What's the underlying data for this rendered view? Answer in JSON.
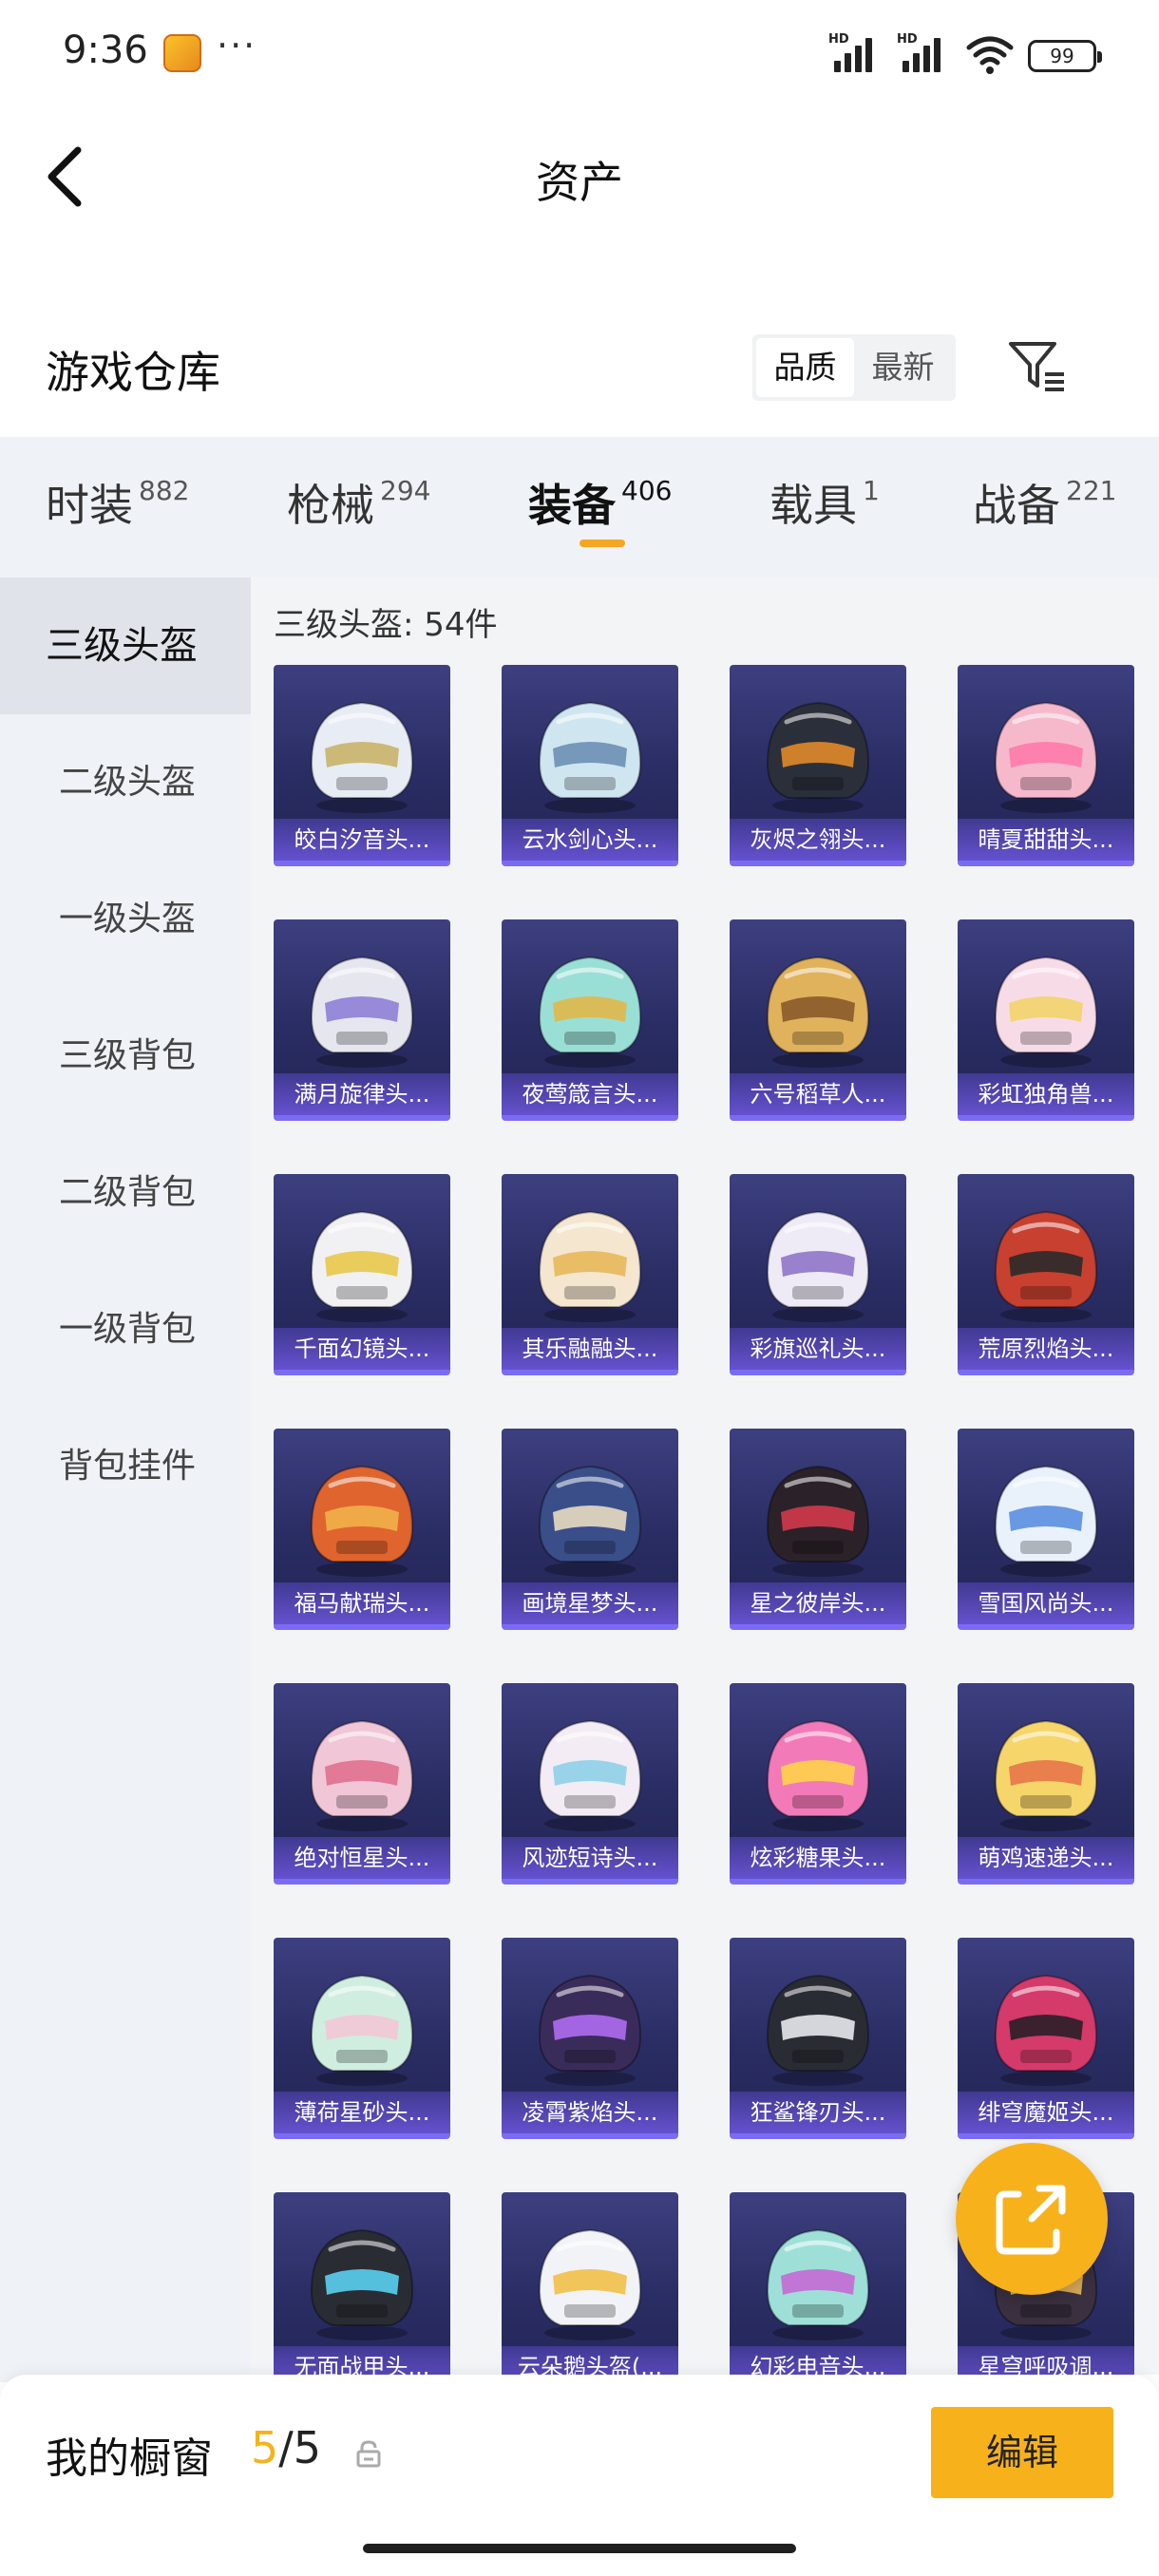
{
  "status_bar": {
    "time": "9:36",
    "more": "···",
    "network1": "HD",
    "network2": "HD",
    "battery": "99"
  },
  "header": {
    "title": "资产"
  },
  "section": {
    "title": "游戏仓库"
  },
  "sort": {
    "options": [
      "品质",
      "最新"
    ],
    "active": "品质"
  },
  "tabs": [
    {
      "label": "时装",
      "count": "882"
    },
    {
      "label": "枪械",
      "count": "294"
    },
    {
      "label": "装备",
      "count": "406",
      "active": true
    },
    {
      "label": "载具",
      "count": "1"
    },
    {
      "label": "战备",
      "count": "221"
    }
  ],
  "sidebar": {
    "items": [
      "三级头盔",
      "二级头盔",
      "一级头盔",
      "三级背包",
      "二级背包",
      "一级背包",
      "背包挂件"
    ],
    "active": "三级头盔"
  },
  "grid": {
    "label": "三级头盔: 54件",
    "items": [
      {
        "name": "皎白汐音头...",
        "color": "#e8ecf4",
        "accent": "#c9b46a"
      },
      {
        "name": "云水剑心头...",
        "color": "#cfe6f0",
        "accent": "#6a8fb5"
      },
      {
        "name": "灰烬之翎头...",
        "color": "#2b2f3a",
        "accent": "#e08a2a"
      },
      {
        "name": "晴夏甜甜头...",
        "color": "#f6b9cc",
        "accent": "#ff7aa8"
      },
      {
        "name": "满月旋律头...",
        "color": "#e6e6ef",
        "accent": "#8e7fd6"
      },
      {
        "name": "夜莺箴言头...",
        "color": "#9adfd6",
        "accent": "#e0b84a"
      },
      {
        "name": "六号稻草人...",
        "color": "#e0b25b",
        "accent": "#8a5a2a"
      },
      {
        "name": "彩虹独角兽...",
        "color": "#f7dce8",
        "accent": "#f2d36a"
      },
      {
        "name": "千面幻镜头...",
        "color": "#f1f1f4",
        "accent": "#e8c84a"
      },
      {
        "name": "其乐融融头...",
        "color": "#f4e6cf",
        "accent": "#e8b85a"
      },
      {
        "name": "彩旗巡礼头...",
        "color": "#eeeaf6",
        "accent": "#8f76c9"
      },
      {
        "name": "荒原烈焰头...",
        "color": "#c8402f",
        "accent": "#2a2a2a"
      },
      {
        "name": "福马献瑞头...",
        "color": "#e0642e",
        "accent": "#f2b04a"
      },
      {
        "name": "画境星梦头...",
        "color": "#3a4e8a",
        "accent": "#e9dcc0"
      },
      {
        "name": "星之彼岸头...",
        "color": "#2a2228",
        "accent": "#d23a4a"
      },
      {
        "name": "雪国风尚头...",
        "color": "#e9f1fb",
        "accent": "#5b8fe0"
      },
      {
        "name": "绝对恒星头...",
        "color": "#f1c6d6",
        "accent": "#e0708f"
      },
      {
        "name": "风迹短诗头...",
        "color": "#f3ecf4",
        "accent": "#8fd0e8"
      },
      {
        "name": "炫彩糖果头...",
        "color": "#f37ab9",
        "accent": "#ffd34a"
      },
      {
        "name": "萌鸡速递头...",
        "color": "#f6d56a",
        "accent": "#e8764a"
      },
      {
        "name": "薄荷星砂头...",
        "color": "#cfeee0",
        "accent": "#f2c6d6"
      },
      {
        "name": "凌霄紫焰头...",
        "color": "#3a2c5a",
        "accent": "#b06cf2"
      },
      {
        "name": "狂鲨锋刃头...",
        "color": "#2a2c34",
        "accent": "#e8e8ee"
      },
      {
        "name": "绯穹魔姬头...",
        "color": "#d43a6a",
        "accent": "#2a1f28"
      },
      {
        "name": "无面战甲头...",
        "color": "#2a2c34",
        "accent": "#5ad0f0"
      },
      {
        "name": "云朵鹅头盔(...",
        "color": "#f2f3f6",
        "accent": "#f2c04a"
      },
      {
        "name": "幻彩电音头...",
        "color": "#9ee0d8",
        "accent": "#c46ad6"
      },
      {
        "name": "星穹呼吸调...",
        "color": "#3a3040",
        "accent": "#e8b85a"
      }
    ]
  },
  "bottom": {
    "label": "我的橱窗",
    "current": "5",
    "total": "/5",
    "edit": "编辑"
  }
}
